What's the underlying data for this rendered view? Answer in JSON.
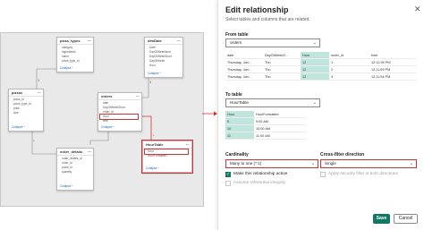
{
  "model": {
    "tables": [
      {
        "id": "pizza_types",
        "name": "pizza_types",
        "fields": [
          "category",
          "ingredients",
          "name",
          "pizza_type_id"
        ],
        "footer": "Collapse ^"
      },
      {
        "id": "dimDate",
        "name": "dimDate",
        "fields": [
          "Date",
          "DayOfWeekNum",
          "DayOfWeekShort",
          "DayOfWeek",
          "Hour"
        ],
        "footer": "Collapse ^"
      },
      {
        "id": "pizzas",
        "name": "pizzas",
        "fields": [
          "pizza_id",
          "pizza_type_id",
          "price",
          "size"
        ],
        "footer": "Collapse ^"
      },
      {
        "id": "orders",
        "name": "orders",
        "fields": [
          "date",
          "DayOfWeekShort",
          "order_id",
          "Hour",
          "time"
        ],
        "footer": "Collapse ^",
        "highlight": "Hour"
      },
      {
        "id": "HourTable",
        "name": "HourTable",
        "fields": [
          "Hour",
          "HourFormatted"
        ],
        "footer": "Collapse ^",
        "highlight": "Hour"
      },
      {
        "id": "order_details",
        "name": "order_details",
        "fields": [
          "order_details_id",
          "order_id",
          "pizza_id",
          "quantity"
        ],
        "footer": "Collapse ^"
      }
    ],
    "relation_labels": [
      "1",
      "*",
      "1",
      "*",
      "1",
      "*",
      "1",
      "*"
    ]
  },
  "panel": {
    "title": "Edit relationship",
    "subtitle": "Select tables and columns that are related.",
    "close_glyph": "✕",
    "from_label": "From table",
    "from_table": "orders",
    "from_grid": {
      "columns": [
        "date",
        "DayOfWeekS...",
        "Hour",
        "order_id",
        "time"
      ],
      "selected_col": 2,
      "rows": [
        [
          "Thursday, Jan...",
          "Thu",
          "12",
          "1",
          "12:12:39 PM"
        ],
        [
          "Thursday, Jan...",
          "Thu",
          "12",
          "2",
          "12:11:59 PM"
        ],
        [
          "Thursday, Jan...",
          "Thu",
          "12",
          "3",
          "12:11:54 PM"
        ]
      ]
    },
    "to_label": "To table",
    "to_table": "HourTable",
    "to_grid": {
      "columns": [
        "Hour",
        "HourFormatted"
      ],
      "selected_col": 0,
      "rows": [
        [
          "9",
          "9:00 AM"
        ],
        [
          "10",
          "10:00 AM"
        ],
        [
          "11",
          "11:00 AM"
        ]
      ]
    },
    "cardinality_label": "Cardinality",
    "cardinality_value": "Many to one (*:1)",
    "crossfilter_label": "Cross-filter direction",
    "crossfilter_value": "Single",
    "make_active_label": "Make this relationship active",
    "make_active_checked": true,
    "assume_ri_label": "Assume referential integrity",
    "assume_ri_checked": false,
    "security_label": "Apply security filter in both directions",
    "security_checked": false,
    "save_label": "Save",
    "cancel_label": "Cancel",
    "chevron": "⌄",
    "check": "✓"
  },
  "colors": {
    "accent": "#117865",
    "highlight": "#d13438",
    "selected_col": "#bfe5dc"
  }
}
